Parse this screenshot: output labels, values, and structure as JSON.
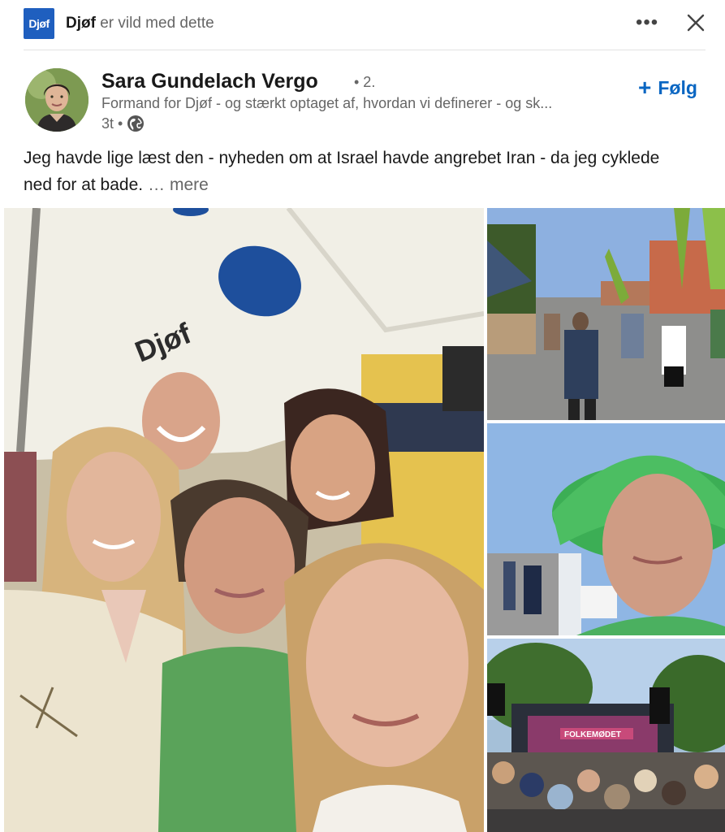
{
  "activity": {
    "org_logo_text": "Djøf",
    "org_name": "Djøf",
    "action_text": "er vild med dette",
    "more_icon": "more-horizontal-icon",
    "close_icon": "close-icon"
  },
  "author": {
    "name": "Sara Gundelach Vergo",
    "degree": "• 2.",
    "headline": "Formand for Djøf - og stærkt optaget af, hvordan vi definerer - og sk...",
    "time": "3t •",
    "visibility_icon": "globe-icon",
    "follow_label": "Følg",
    "follow_icon": "plus-icon"
  },
  "post": {
    "text": "Jeg havde lige læst den - nyheden om at Israel havde angrebet Iran - da jeg cyklede ned for at bade.",
    "more_label": "… mere"
  },
  "media": {
    "main_tent_text": "Djøf",
    "stage_banner_text": "FOLKEMØDET"
  },
  "colors": {
    "accent": "#0a66c2",
    "brand": "#1f5fbf",
    "secondary_text": "#666666"
  }
}
